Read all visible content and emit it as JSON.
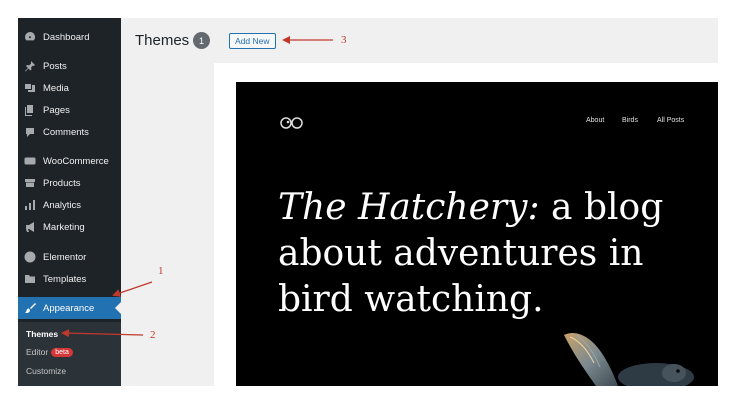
{
  "sidebar": {
    "items": [
      {
        "label": "Dashboard",
        "icon": "dashboard-icon"
      },
      {
        "label": "Posts",
        "icon": "pin-icon"
      },
      {
        "label": "Media",
        "icon": "media-icon"
      },
      {
        "label": "Pages",
        "icon": "pages-icon"
      },
      {
        "label": "Comments",
        "icon": "comment-icon"
      },
      {
        "label": "WooCommerce",
        "icon": "woocommerce-icon"
      },
      {
        "label": "Products",
        "icon": "archive-icon"
      },
      {
        "label": "Analytics",
        "icon": "bar-chart-icon"
      },
      {
        "label": "Marketing",
        "icon": "megaphone-icon"
      },
      {
        "label": "Elementor",
        "icon": "elementor-icon"
      },
      {
        "label": "Templates",
        "icon": "folder-icon"
      },
      {
        "label": "Appearance",
        "icon": "paintbrush-icon"
      }
    ],
    "submenu": {
      "themes": "Themes",
      "editor": "Editor",
      "editor_badge": "beta",
      "customize": "Customize"
    }
  },
  "header": {
    "title": "Themes",
    "count": "1",
    "add_new": "Add New"
  },
  "preview": {
    "nav": [
      "About",
      "Birds",
      "All Posts"
    ],
    "hero_italic": "The Hatchery:",
    "hero_rest": " a blog about adventures in bird watching."
  },
  "annotations": [
    "1",
    "2",
    "3"
  ],
  "colors": {
    "sidebar_bg": "#1d2327",
    "active": "#2271b1",
    "annotation": "#c0392b",
    "badge": "#d63638"
  }
}
